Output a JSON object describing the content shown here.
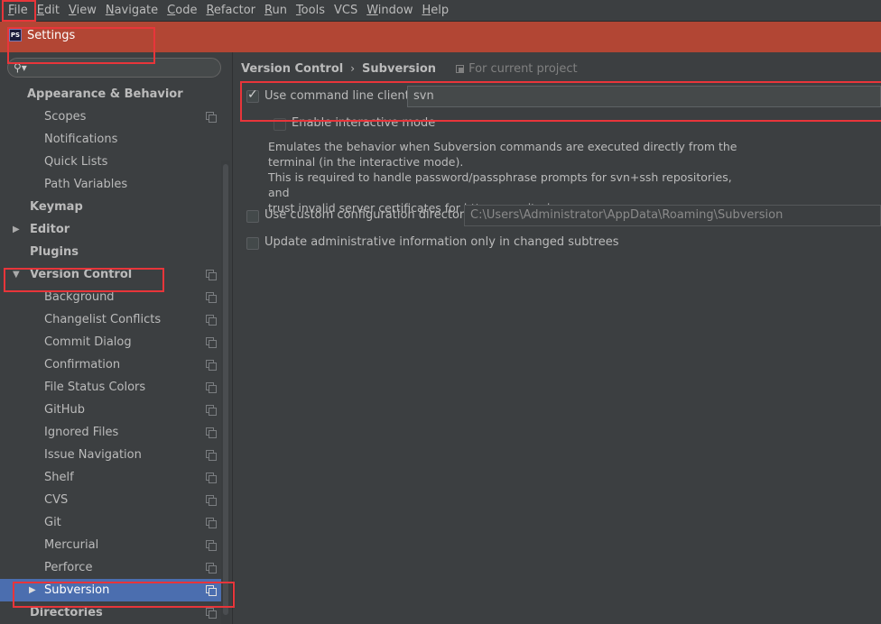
{
  "menubar": {
    "items": [
      {
        "mnemonic": "F",
        "rest": "ile"
      },
      {
        "mnemonic": "E",
        "rest": "dit"
      },
      {
        "mnemonic": "V",
        "rest": "iew"
      },
      {
        "mnemonic": "N",
        "rest": "avigate"
      },
      {
        "mnemonic": "C",
        "rest": "ode"
      },
      {
        "mnemonic": "R",
        "rest": "efactor"
      },
      {
        "mnemonic": "R",
        "rest": "un"
      },
      {
        "mnemonic": "T",
        "rest": "ools"
      },
      {
        "mnemonic": "",
        "rest": "VCS"
      },
      {
        "mnemonic": "W",
        "rest": "indow"
      },
      {
        "mnemonic": "H",
        "rest": "elp"
      }
    ]
  },
  "window": {
    "app_icon_text": "PS",
    "title": "Settings"
  },
  "sidebar": {
    "search_placeholder": "",
    "items": [
      {
        "label": "Appearance & Behavior",
        "bold": true,
        "indent": 0,
        "arrow": "",
        "copy_icon": false
      },
      {
        "label": "Scopes",
        "bold": false,
        "indent": 1,
        "arrow": "",
        "copy_icon": true
      },
      {
        "label": "Notifications",
        "bold": false,
        "indent": 1,
        "arrow": "",
        "copy_icon": false
      },
      {
        "label": "Quick Lists",
        "bold": false,
        "indent": 1,
        "arrow": "",
        "copy_icon": false
      },
      {
        "label": "Path Variables",
        "bold": false,
        "indent": 1,
        "arrow": "",
        "copy_icon": false
      },
      {
        "label": "Keymap",
        "bold": true,
        "indent": 0,
        "arrow": "",
        "copy_icon": false
      },
      {
        "label": "Editor",
        "bold": true,
        "indent": 0,
        "arrow": "▶",
        "copy_icon": false
      },
      {
        "label": "Plugins",
        "bold": true,
        "indent": 0,
        "arrow": "",
        "copy_icon": false
      },
      {
        "label": "Version Control",
        "bold": true,
        "indent": 0,
        "arrow": "▼",
        "copy_icon": true
      },
      {
        "label": "Background",
        "bold": false,
        "indent": 1,
        "arrow": "",
        "copy_icon": true
      },
      {
        "label": "Changelist Conflicts",
        "bold": false,
        "indent": 1,
        "arrow": "",
        "copy_icon": true
      },
      {
        "label": "Commit Dialog",
        "bold": false,
        "indent": 1,
        "arrow": "",
        "copy_icon": true
      },
      {
        "label": "Confirmation",
        "bold": false,
        "indent": 1,
        "arrow": "",
        "copy_icon": true
      },
      {
        "label": "File Status Colors",
        "bold": false,
        "indent": 1,
        "arrow": "",
        "copy_icon": true
      },
      {
        "label": "GitHub",
        "bold": false,
        "indent": 1,
        "arrow": "",
        "copy_icon": true
      },
      {
        "label": "Ignored Files",
        "bold": false,
        "indent": 1,
        "arrow": "",
        "copy_icon": true
      },
      {
        "label": "Issue Navigation",
        "bold": false,
        "indent": 1,
        "arrow": "",
        "copy_icon": true
      },
      {
        "label": "Shelf",
        "bold": false,
        "indent": 1,
        "arrow": "",
        "copy_icon": true
      },
      {
        "label": "CVS",
        "bold": false,
        "indent": 1,
        "arrow": "",
        "copy_icon": true
      },
      {
        "label": "Git",
        "bold": false,
        "indent": 1,
        "arrow": "",
        "copy_icon": true
      },
      {
        "label": "Mercurial",
        "bold": false,
        "indent": 1,
        "arrow": "",
        "copy_icon": true
      },
      {
        "label": "Perforce",
        "bold": false,
        "indent": 1,
        "arrow": "",
        "copy_icon": true
      },
      {
        "label": "Subversion",
        "bold": false,
        "indent": 1,
        "arrow": "▶",
        "copy_icon": true,
        "selected": true
      },
      {
        "label": "Directories",
        "bold": true,
        "indent": 0,
        "arrow": "",
        "copy_icon": true
      }
    ]
  },
  "main": {
    "breadcrumb": [
      "Version Control",
      "Subversion"
    ],
    "breadcrumb_sep": "›",
    "project_note": "For current project",
    "use_cmd_client": {
      "label": "Use command line client:",
      "checked": true,
      "value": "svn"
    },
    "interactive_mode": {
      "label": "Enable interactive mode",
      "checked": false,
      "enabled": false
    },
    "description": [
      "Emulates the behavior when Subversion commands are executed directly from the",
      "terminal (in the interactive mode).",
      "This is required to handle password/passphrase prompts for svn+ssh repositories, and",
      "trust invalid server certificates for https repositories."
    ],
    "custom_config": {
      "label": "Use custom configuration directory:",
      "checked": false,
      "value": "C:\\Users\\Administrator\\AppData\\Roaming\\Subversion"
    },
    "update_admin": {
      "label": "Update administrative information only in changed subtrees",
      "checked": false
    }
  },
  "colors": {
    "background": "#3c3f41",
    "title_bar": "#b24634",
    "selection": "#4b6eaf",
    "highlight_box": "#e8353a"
  }
}
